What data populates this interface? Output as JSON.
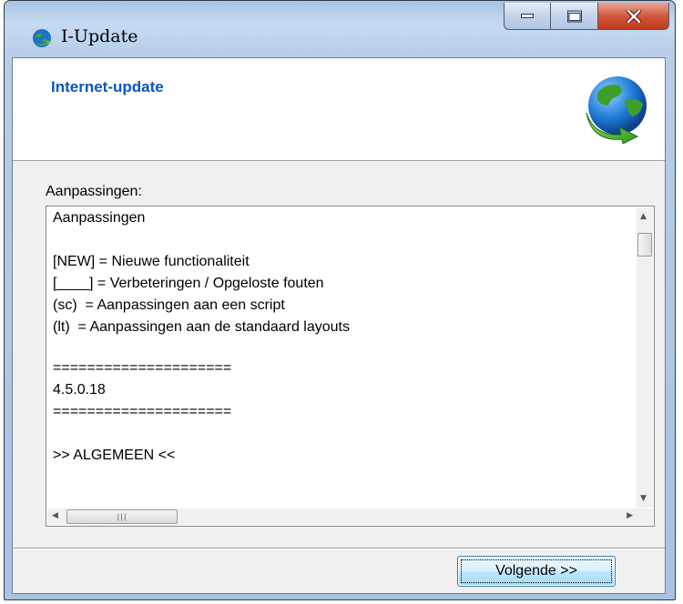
{
  "window": {
    "title": "I-Update",
    "controls": {
      "minimize": "minimize-icon",
      "maximize": "maximize-icon",
      "close": "close-icon"
    }
  },
  "header": {
    "title": "Internet-update",
    "logo_icon": "globe-arrow-icon"
  },
  "changes": {
    "label": "Aanpassingen:",
    "lines": [
      "Aanpassingen",
      "",
      "[NEW] = Nieuwe functionaliteit",
      "[____] = Verbeteringen / Opgeloste fouten",
      "(sc)  = Aanpassingen aan een script",
      "(lt)  = Aanpassingen aan de standaard layouts",
      "",
      "=====================",
      "4.5.0.18",
      "=====================",
      "",
      ">> ALGEMEEN <<"
    ]
  },
  "buttons": {
    "next_label": "Volgende >>"
  },
  "colors": {
    "accent_title": "#0a57b8",
    "close_button": "#c3381c",
    "frame": "#b7cde8"
  }
}
